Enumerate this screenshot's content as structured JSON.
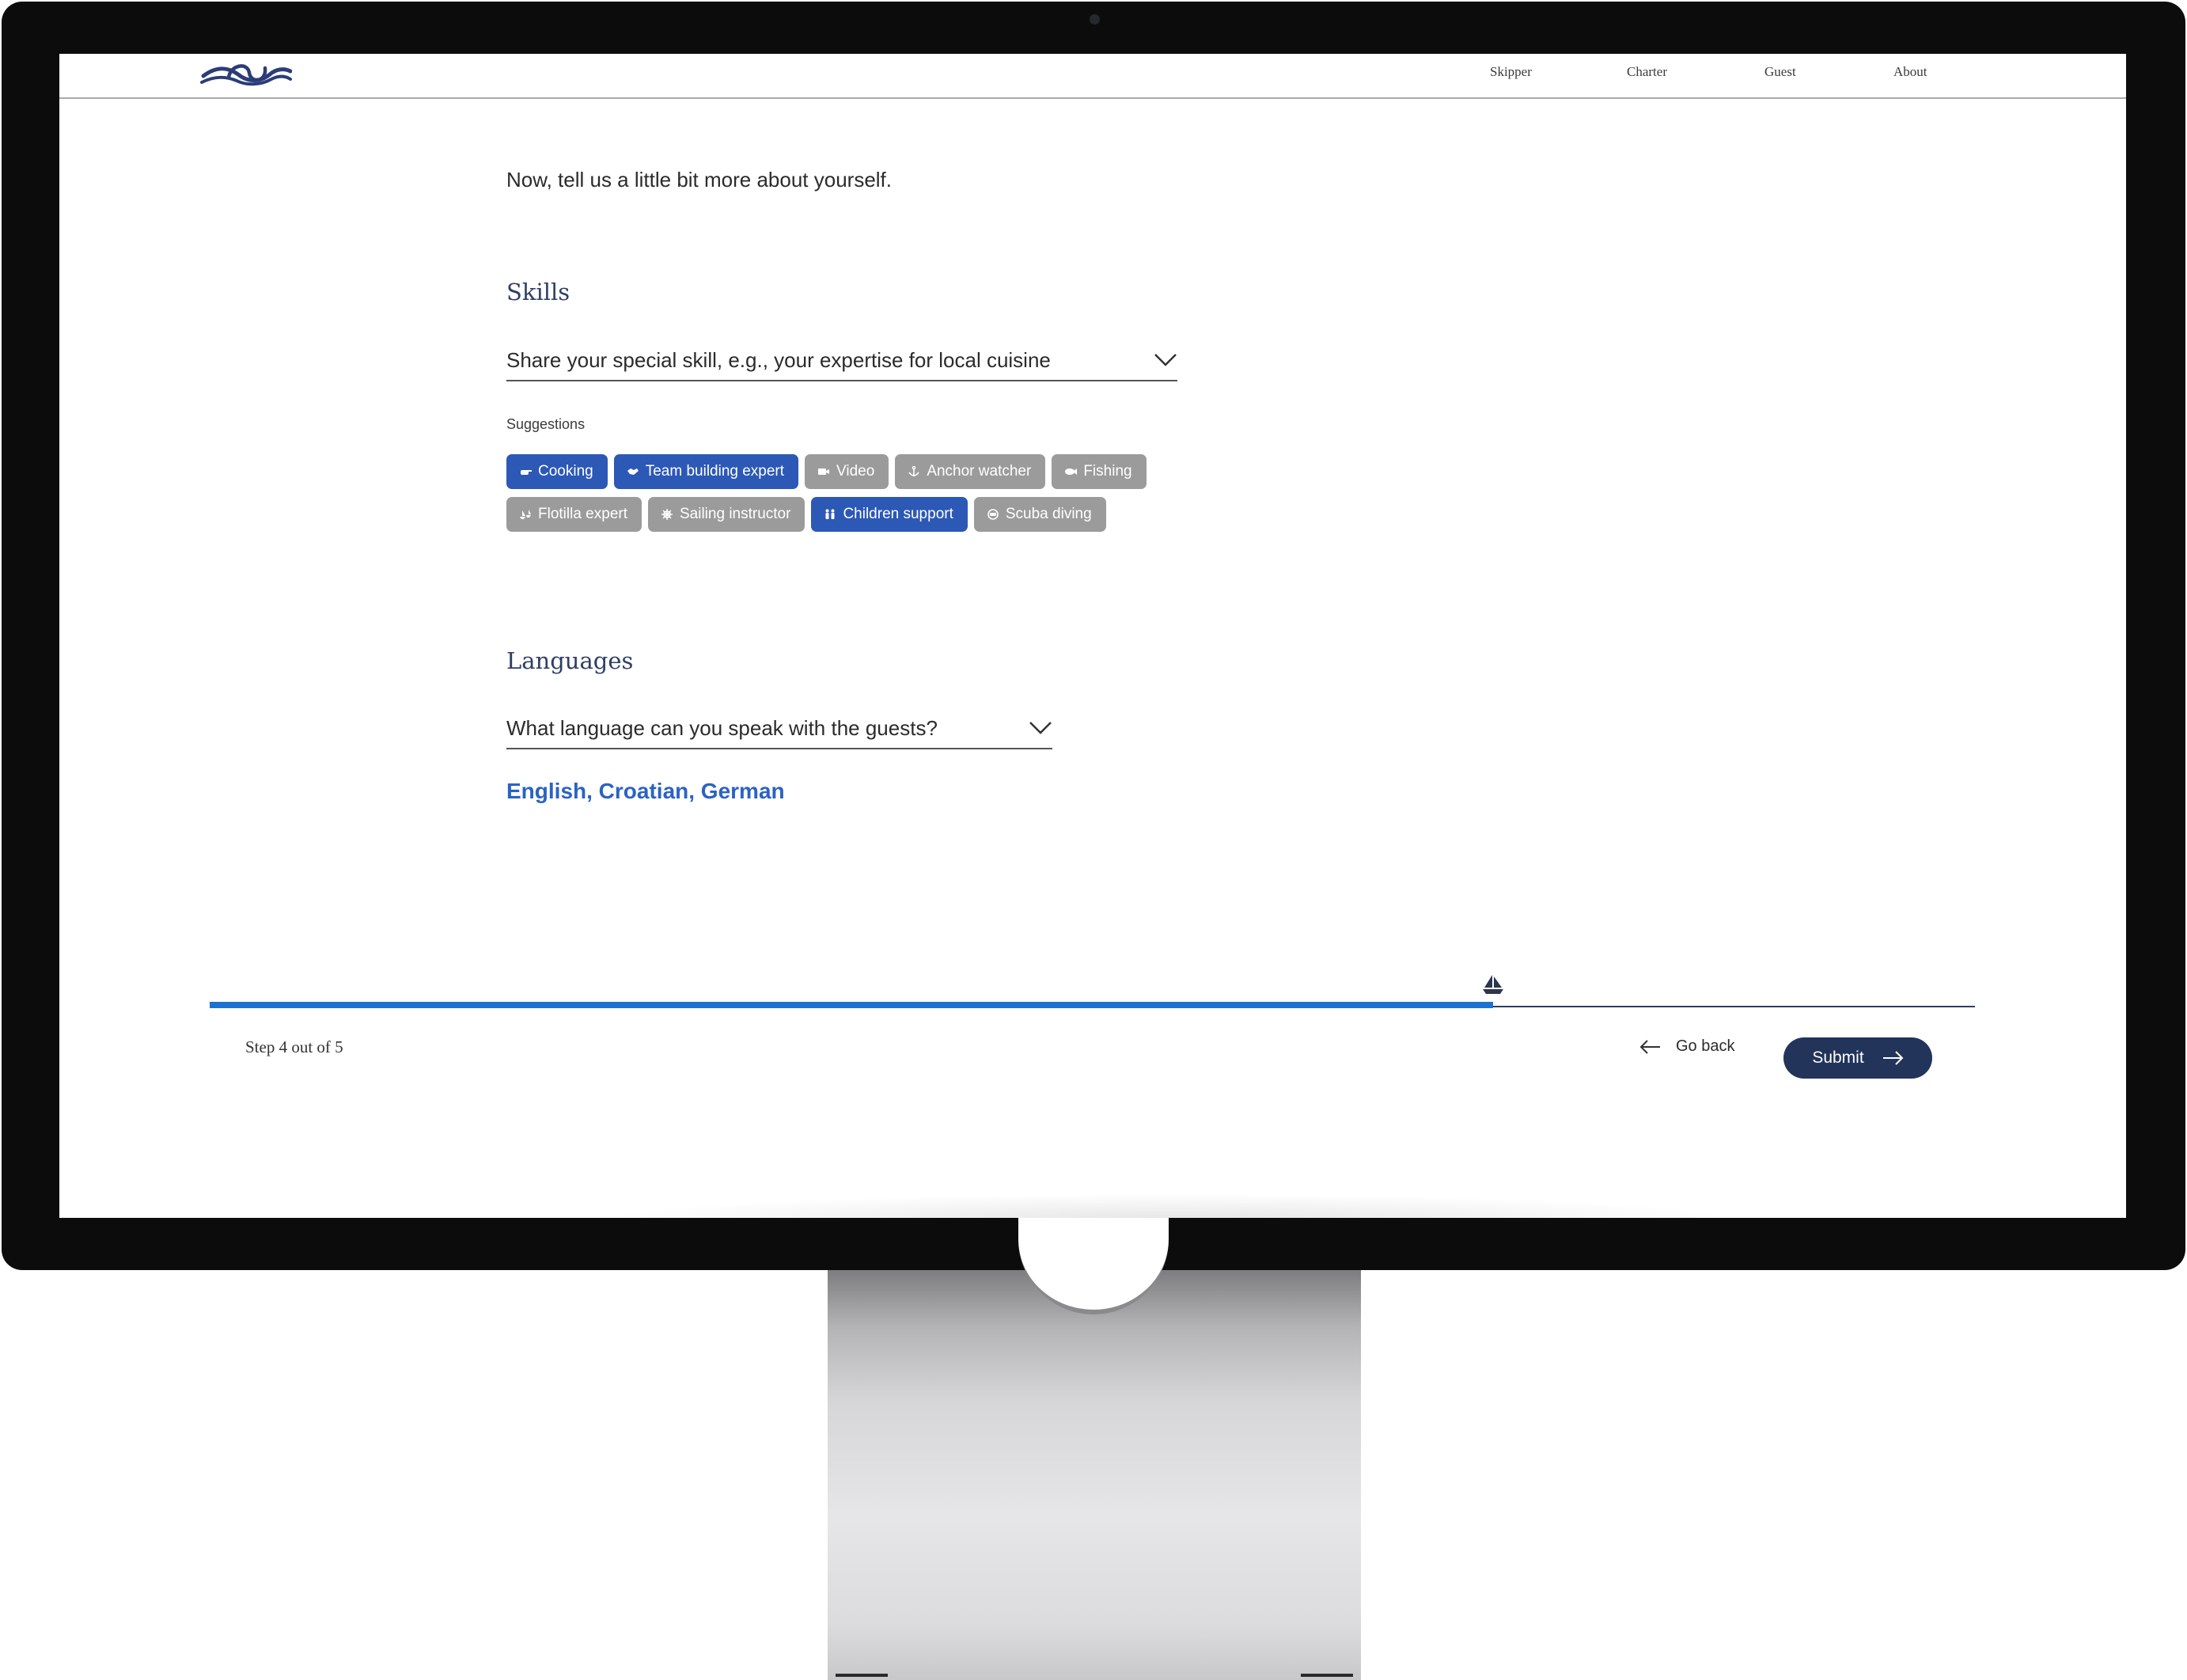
{
  "nav": {
    "items": [
      {
        "label": "Skipper"
      },
      {
        "label": "Charter"
      },
      {
        "label": "Guest"
      },
      {
        "label": "About"
      }
    ]
  },
  "intro": "Now, tell us a little bit more about yourself.",
  "skills": {
    "title": "Skills",
    "placeholder": "Share your special skill, e.g., your expertise for local cuisine",
    "suggestions_label": "Suggestions",
    "chips": [
      {
        "label": "Cooking",
        "icon": "cooking-pot-icon",
        "selected": true
      },
      {
        "label": "Team building expert",
        "icon": "handshake-icon",
        "selected": true
      },
      {
        "label": "Video",
        "icon": "video-camera-icon",
        "selected": false
      },
      {
        "label": "Anchor watcher",
        "icon": "anchor-icon",
        "selected": false
      },
      {
        "label": "Fishing",
        "icon": "fish-icon",
        "selected": false
      },
      {
        "label": "Flotilla expert",
        "icon": "flotilla-icon",
        "selected": false
      },
      {
        "label": "Sailing instructor",
        "icon": "ship-wheel-icon",
        "selected": false
      },
      {
        "label": "Children support",
        "icon": "children-icon",
        "selected": true
      },
      {
        "label": "Scuba diving",
        "icon": "diving-mask-icon",
        "selected": false
      }
    ]
  },
  "languages": {
    "title": "Languages",
    "placeholder": "What language can you speak with the guests?",
    "selected": "English, Croatian, German"
  },
  "progress": {
    "step_text": "Step 4 out of 5",
    "fraction": 0.727
  },
  "actions": {
    "back_label": "Go back",
    "submit_label": "Submit"
  },
  "colors": {
    "selected_chip": "#2c58b6",
    "unselected_chip": "#9b9b9b",
    "progress": "#1e72cf",
    "primary_button": "#22345a",
    "heading": "#2f3e63",
    "languages_text": "#2b63c2"
  }
}
